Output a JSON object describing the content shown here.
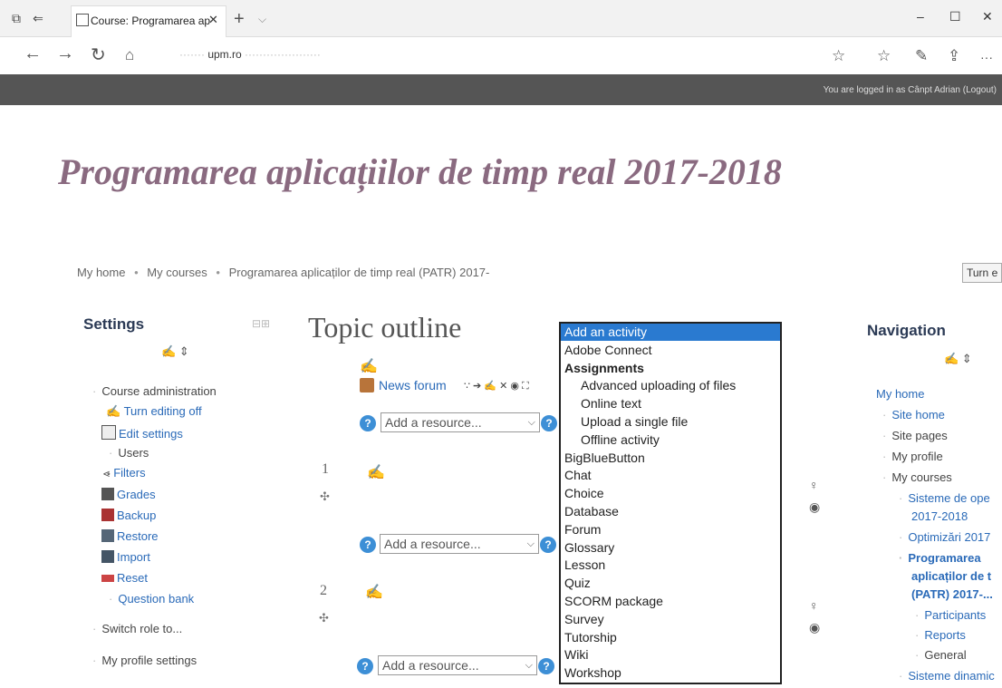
{
  "browser": {
    "tab_title": "Course: Programarea ap",
    "close_glyph": "✕",
    "new_tab_glyph": "+",
    "url_host": "upm.ro",
    "window_min": "–",
    "window_max": "☐",
    "window_close": "✕",
    "more_glyph": "···"
  },
  "topbar": {
    "login_text": "You are logged in as Cânpt Adrian (Logout)"
  },
  "course": {
    "title": "Programarea aplicațiilor de timp real 2017-2018"
  },
  "breadcrumb": {
    "items": [
      "My home",
      "My courses",
      "Programarea aplicaților de timp real (PATR) 2017-"
    ],
    "separator": "•"
  },
  "turn_button": "Turn e",
  "settings": {
    "heading": "Settings",
    "course_admin": "Course administration",
    "turn_editing_off": "Turn editing off",
    "edit_settings": "Edit settings",
    "users": "Users",
    "filters": "Filters",
    "grades": "Grades",
    "backup": "Backup",
    "restore": "Restore",
    "import": "Import",
    "reset": "Reset",
    "question_bank": "Question bank",
    "switch_role": "Switch role to...",
    "my_profile_settings": "My profile settings"
  },
  "topic": {
    "heading": "Topic outline",
    "news_forum": "News forum",
    "add_resource": "Add a resource...",
    "help_glyph": "?",
    "section_numbers": [
      "1",
      "2"
    ]
  },
  "activity_dropdown": {
    "items": [
      {
        "label": "Add an activity",
        "kind": "selected"
      },
      {
        "label": "Adobe Connect",
        "kind": "item"
      },
      {
        "label": "Assignments",
        "kind": "group"
      },
      {
        "label": "Advanced uploading of files",
        "kind": "indent"
      },
      {
        "label": "Online text",
        "kind": "indent"
      },
      {
        "label": "Upload a single file",
        "kind": "indent"
      },
      {
        "label": "Offline activity",
        "kind": "indent"
      },
      {
        "label": "BigBlueButton",
        "kind": "item"
      },
      {
        "label": "Chat",
        "kind": "item"
      },
      {
        "label": "Choice",
        "kind": "item"
      },
      {
        "label": "Database",
        "kind": "item"
      },
      {
        "label": "Forum",
        "kind": "item"
      },
      {
        "label": "Glossary",
        "kind": "item"
      },
      {
        "label": "Lesson",
        "kind": "item"
      },
      {
        "label": "Quiz",
        "kind": "item"
      },
      {
        "label": "SCORM package",
        "kind": "item"
      },
      {
        "label": "Survey",
        "kind": "item"
      },
      {
        "label": "Tutorship",
        "kind": "item"
      },
      {
        "label": "Wiki",
        "kind": "item"
      },
      {
        "label": "Workshop",
        "kind": "item"
      }
    ]
  },
  "navigation": {
    "heading": "Navigation",
    "my_home": "My home",
    "site_home": "Site home",
    "site_pages": "Site pages",
    "my_profile": "My profile",
    "my_courses": "My courses",
    "course1_line1": "Sisteme de ope",
    "course1_line2": "2017-2018",
    "course2": "Optimizări 2017",
    "course3_line1": "Programarea",
    "course3_line2": "aplicaților de t",
    "course3_line3": "(PATR) 2017-...",
    "participants": "Participants",
    "reports": "Reports",
    "general": "General",
    "course4": "Sisteme dinamic"
  }
}
